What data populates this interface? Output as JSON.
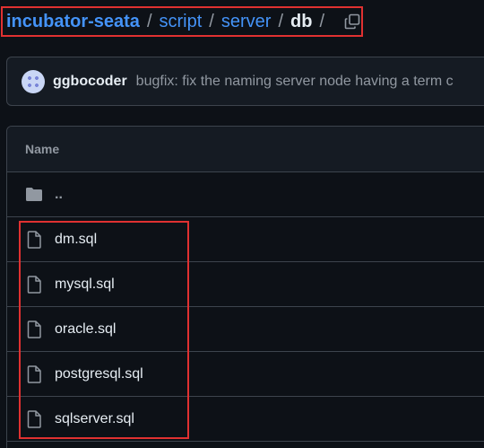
{
  "breadcrumb": {
    "repo": "incubator-seata",
    "path": [
      "script",
      "server"
    ],
    "current": "db",
    "separator": "/",
    "copy_icon": "copy-icon"
  },
  "commit": {
    "author": "ggbocoder",
    "message": "bugfix: fix the naming server node having a term c"
  },
  "table": {
    "header": "Name",
    "parent_label": "..",
    "files": [
      {
        "name": "dm.sql",
        "icon": "file-icon"
      },
      {
        "name": "mysql.sql",
        "icon": "file-icon"
      },
      {
        "name": "oracle.sql",
        "icon": "file-icon"
      },
      {
        "name": "postgresql.sql",
        "icon": "file-icon"
      },
      {
        "name": "sqlserver.sql",
        "icon": "file-icon"
      }
    ]
  },
  "colors": {
    "background": "#0d1117",
    "link": "#4493f8",
    "muted": "#9198a1",
    "border": "#3d444d",
    "highlight": "#e03131"
  }
}
